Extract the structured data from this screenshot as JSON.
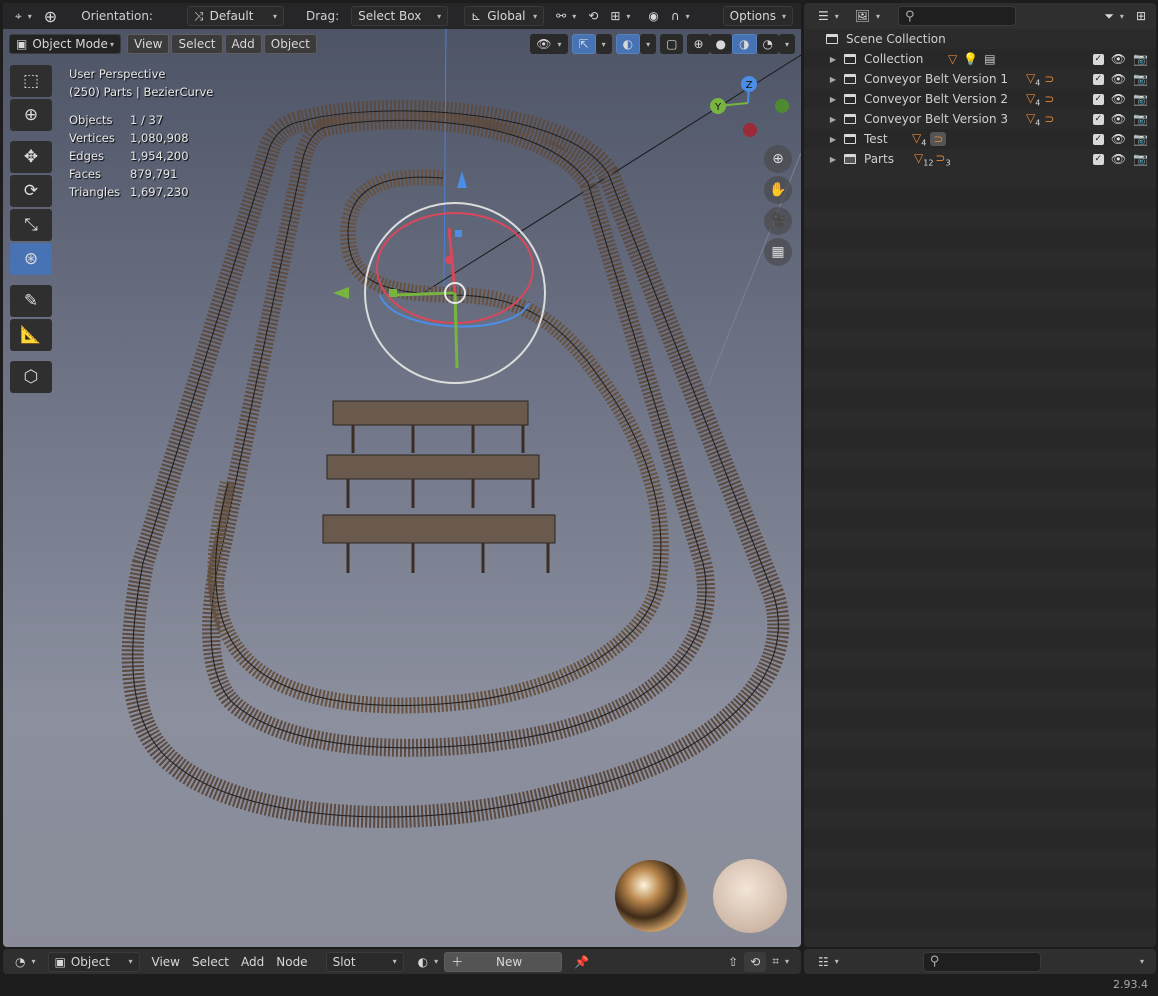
{
  "viewport": {
    "header": {
      "orientation_label": "Orientation:",
      "orientation_value": "Default",
      "drag_label": "Drag:",
      "drag_value": "Select Box",
      "transform_space": "Global",
      "options": "Options"
    },
    "mode": "Object Mode",
    "menus": [
      "View",
      "Select",
      "Add",
      "Object"
    ],
    "overlay": {
      "perspective": "User Perspective",
      "context": "(250) Parts | BezierCurve"
    },
    "stats": [
      {
        "label": "Objects",
        "value": "1 / 37"
      },
      {
        "label": "Vertices",
        "value": "1,080,908"
      },
      {
        "label": "Edges",
        "value": "1,954,200"
      },
      {
        "label": "Faces",
        "value": "879,791"
      },
      {
        "label": "Triangles",
        "value": "1,697,230"
      }
    ],
    "gizmo_axes": {
      "z": "Z",
      "y": "Y"
    }
  },
  "outliner": {
    "root": "Scene Collection",
    "items": [
      {
        "name": "Collection"
      },
      {
        "name": "Conveyor Belt Version 1",
        "badge": "4"
      },
      {
        "name": "Conveyor Belt Version 2",
        "badge": "4"
      },
      {
        "name": "Conveyor Belt Version 3",
        "badge": "4"
      },
      {
        "name": "Test",
        "badge": "4"
      },
      {
        "name": "Parts",
        "badge": "12",
        "badge2": "3"
      }
    ]
  },
  "shader_editor": {
    "object_type": "Object",
    "menus": [
      "View",
      "Select",
      "Add",
      "Node"
    ],
    "slot": "Slot",
    "new": "New"
  },
  "status": {
    "version": "2.93.4"
  },
  "colors": {
    "accent": "#4772b3",
    "x_axis": "#e0485a",
    "y_axis": "#77b540",
    "z_axis": "#4a8ee6",
    "orange": "#e0883a"
  }
}
